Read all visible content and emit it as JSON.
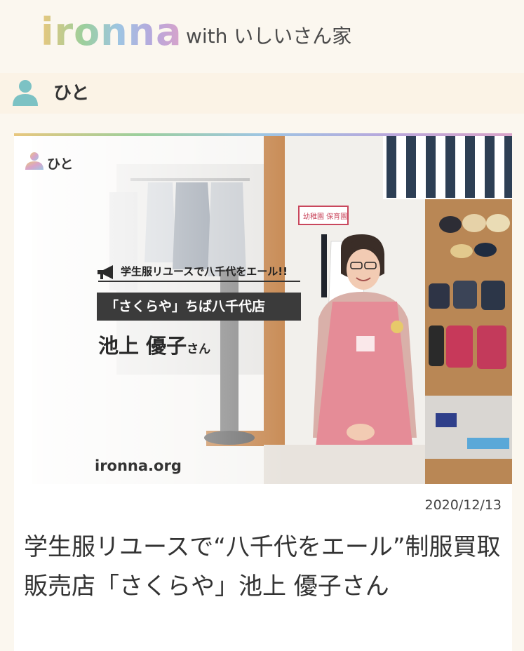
{
  "header": {
    "logo": "ironna",
    "subtitle": "with いしいさん家"
  },
  "section": {
    "label": "ひと",
    "icon": "person-icon"
  },
  "article": {
    "hero": {
      "badge_label": "ひと",
      "tagline": "学生服リユースで八千代をエール!!",
      "shop_name": "「さくらや」ちば八千代店",
      "person_name": "池上 優子",
      "honorific": "さん",
      "site": "ironna.org",
      "sign_text": "幼稚園 保育園"
    },
    "date": "2020/12/13",
    "title": "学生服リユースで“八千代をエール”制服買取販売店「さくらや」池上 優子さん"
  },
  "colors": {
    "background": "#fbf7ef",
    "section_bar": "#fbf3e6",
    "person_icon": "#7cc2c4",
    "apron": "#e58c97"
  }
}
